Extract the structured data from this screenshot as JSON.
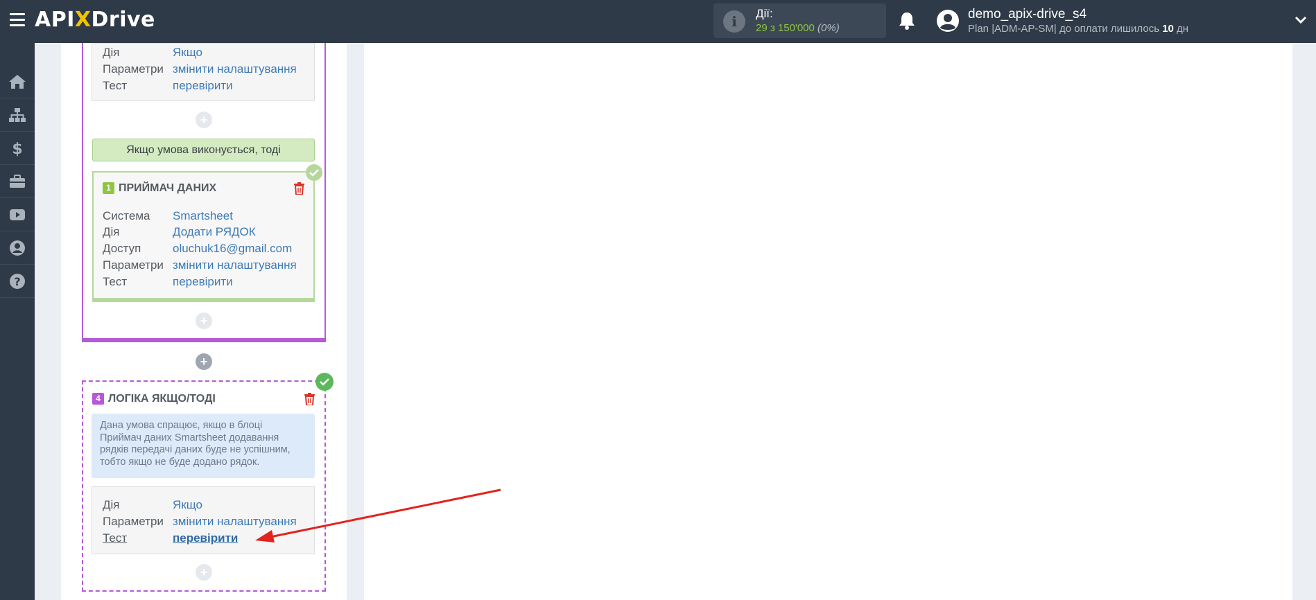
{
  "header": {
    "logo_left": "API",
    "logo_x": "X",
    "logo_right": "Drive",
    "actions_label": "Дії:",
    "actions_used": "29",
    "actions_sep": "з",
    "actions_total": "150'000",
    "actions_percent": "(0%)",
    "username": "demo_apix-drive_s4",
    "plan_text": "Plan |ADM-AP-SM| до оплати лишилось",
    "plan_days": "10",
    "plan_unit": "дн"
  },
  "sidebar": {
    "items": [
      {
        "icon": "home-icon"
      },
      {
        "icon": "sitemap-icon"
      },
      {
        "icon": "dollar-icon"
      },
      {
        "icon": "briefcase-icon"
      },
      {
        "icon": "youtube-icon"
      },
      {
        "icon": "user-circle-icon"
      },
      {
        "icon": "question-circle-icon"
      }
    ]
  },
  "top_card": {
    "rows": [
      {
        "key": "Дія",
        "value": "Якщо"
      },
      {
        "key": "Параметри",
        "value": "змінити налаштування"
      },
      {
        "key": "Тест",
        "value": "перевірити"
      }
    ]
  },
  "condition_bar": "Якщо умова виконується, тоді",
  "receiver": {
    "number": "1",
    "title": "ПРИЙМАЧ ДАНИХ",
    "rows": [
      {
        "key": "Система",
        "value": "Smartsheet"
      },
      {
        "key": "Дія",
        "value": "Додати РЯДОК"
      },
      {
        "key": "Доступ",
        "value": "oluchuk16@gmail.com"
      },
      {
        "key": "Параметри",
        "value": "змінити налаштування"
      },
      {
        "key": "Тест",
        "value": "перевірити"
      }
    ]
  },
  "logic": {
    "number": "4",
    "title": "ЛОГІКА ЯКЩО/ТОДІ",
    "note": "Дана умова спрацює, якщо в блоці Приймач даних Smartsheet додавання рядків передачі даних буде не успішним, тобто якщо не буде додано рядок.",
    "rows": [
      {
        "key": "Дія",
        "value": "Якщо"
      },
      {
        "key": "Параметри",
        "value": "змінити налаштування"
      },
      {
        "key": "Тест",
        "value": "перевірити"
      }
    ]
  },
  "plus_symbol": "+",
  "colors": {
    "topbar": "#2e3a47",
    "accent_purple": "#b559d8",
    "accent_green": "#8fc640",
    "link_blue": "#3d7ab6",
    "danger_red": "#d9362b",
    "arrow_red": "#e3231e"
  }
}
